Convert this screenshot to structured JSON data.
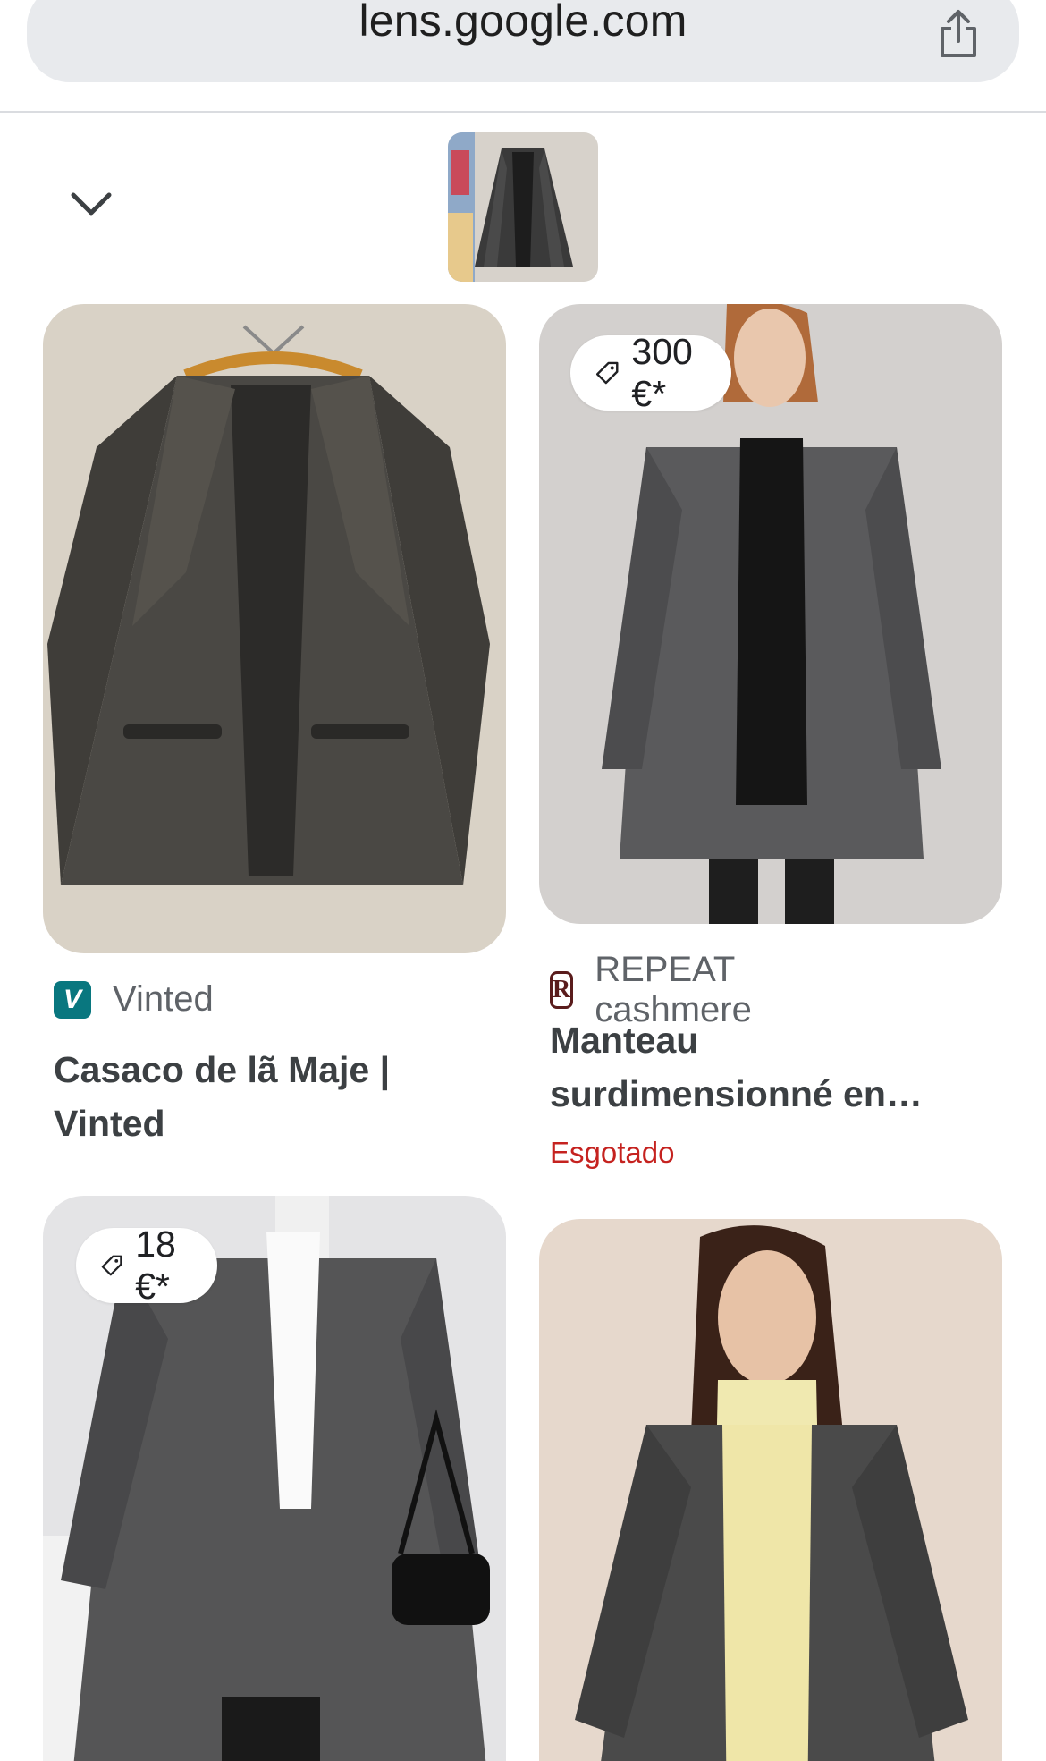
{
  "browser": {
    "url": "lens.google.com"
  },
  "header": {
    "collapse_icon": "chevron-down-icon",
    "share_icon": "share-icon"
  },
  "results": [
    {
      "source": "Vinted",
      "title": "Casaco de lã Maje | Vinted",
      "price": "",
      "status": ""
    },
    {
      "source": "REPEAT cashmere",
      "title": "Manteau surdimensionné en…",
      "price": "300 €*",
      "status": "Esgotado"
    },
    {
      "source": "",
      "title": "",
      "price": "18 €*",
      "status": ""
    },
    {
      "source": "",
      "title": "",
      "price": "",
      "status": ""
    }
  ],
  "colors": {
    "urlbar_bg": "#e8eaed",
    "status_red": "#c5221f",
    "vinted_teal": "#09777f",
    "source_gray": "#5f6368"
  }
}
